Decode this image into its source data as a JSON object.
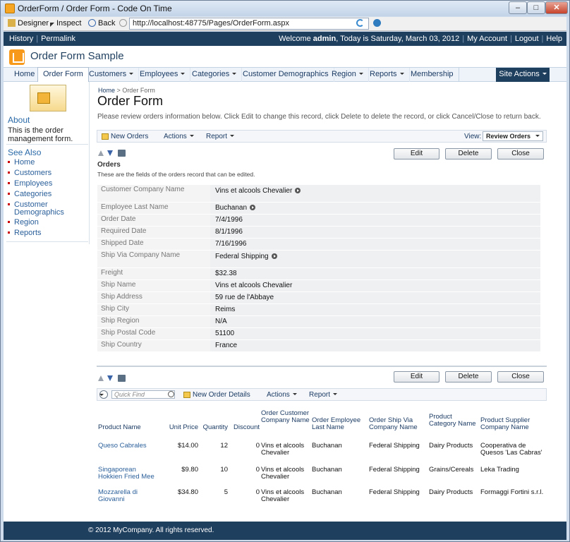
{
  "window": {
    "title": "OrderForm / Order Form - Code On Time"
  },
  "browser": {
    "designer": "Designer",
    "inspect": "Inspect",
    "back": "Back",
    "url": "http://localhost:48775/Pages/OrderForm.aspx"
  },
  "topbar": {
    "history": "History",
    "permalink": "Permalink",
    "welcome_prefix": "Welcome ",
    "user": "admin",
    "welcome_suffix": ", Today is Saturday, March 03, 2012",
    "my_account": "My Account",
    "logout": "Logout",
    "help": "Help"
  },
  "app": {
    "title": "Order Form Sample"
  },
  "menu": {
    "items": [
      "Home",
      "Order Form",
      "Customers",
      "Employees",
      "Categories",
      "Customer Demographics",
      "Region",
      "Reports",
      "Membership"
    ],
    "site_actions": "Site Actions"
  },
  "sidebar": {
    "about_h": "About",
    "about_text": "This is the order management form.",
    "seealso_h": "See Also",
    "links": [
      "Home",
      "Customers",
      "Employees",
      "Categories",
      "Customer Demographics",
      "Region",
      "Reports"
    ]
  },
  "page": {
    "crumb_home": "Home",
    "crumb_sep": ">",
    "crumb_current": "Order Form",
    "title": "Order Form",
    "description": "Please review orders information below. Click Edit to change this record, click Delete to delete the record, or click Cancel/Close to return back."
  },
  "actionbar": {
    "new_orders": "New Orders",
    "actions": "Actions",
    "report": "Report",
    "view_label": "View:",
    "view_value": "Review Orders"
  },
  "buttons": {
    "edit": "Edit",
    "delete": "Delete",
    "close": "Close"
  },
  "orders": {
    "title": "Orders",
    "desc": "These are the fields of the orders record that can be edited.",
    "fields": [
      {
        "label": "Customer Company Name",
        "value": "Vins et alcools Chevalier"
      },
      {
        "label": "Employee Last Name",
        "value": "Buchanan"
      },
      {
        "label": "Order Date",
        "value": "7/4/1996"
      },
      {
        "label": "Required Date",
        "value": "8/1/1996"
      },
      {
        "label": "Shipped Date",
        "value": "7/16/1996"
      },
      {
        "label": "Ship Via Company Name",
        "value": "Federal Shipping"
      },
      {
        "label": "Freight",
        "value": "$32.38"
      },
      {
        "label": "Ship Name",
        "value": "Vins et alcools Chevalier"
      },
      {
        "label": "Ship Address",
        "value": "59 rue de l'Abbaye"
      },
      {
        "label": "Ship City",
        "value": "Reims"
      },
      {
        "label": "Ship Region",
        "value": "N/A"
      },
      {
        "label": "Ship Postal Code",
        "value": "51100"
      },
      {
        "label": "Ship Country",
        "value": "France"
      }
    ]
  },
  "details": {
    "quick_find": "Quick Find",
    "new_order_details": "New Order Details",
    "actions": "Actions",
    "report": "Report",
    "headers": [
      "Product Name",
      "Unit Price",
      "Quantity",
      "Discount",
      "Order Customer Company Name",
      "Order Employee Last Name",
      "Order Ship Via Company Name",
      "Product Category Name",
      "Product Supplier Company Name"
    ],
    "rows": [
      {
        "product": "Queso Cabrales",
        "price": "$14.00",
        "qty": "12",
        "discount": "0",
        "customer": "Vins et alcools Chevalier",
        "employee": "Buchanan",
        "shipvia": "Federal Shipping",
        "category": "Dairy Products",
        "supplier": "Cooperativa de Quesos 'Las Cabras'"
      },
      {
        "product": "Singaporean Hokkien Fried Mee",
        "price": "$9.80",
        "qty": "10",
        "discount": "0",
        "customer": "Vins et alcools Chevalier",
        "employee": "Buchanan",
        "shipvia": "Federal Shipping",
        "category": "Grains/Cereals",
        "supplier": "Leka Trading"
      },
      {
        "product": "Mozzarella di Giovanni",
        "price": "$34.80",
        "qty": "5",
        "discount": "0",
        "customer": "Vins et alcools Chevalier",
        "employee": "Buchanan",
        "shipvia": "Federal Shipping",
        "category": "Dairy Products",
        "supplier": "Formaggi Fortini s.r.l."
      }
    ]
  },
  "footer": {
    "text": "© 2012 MyCompany. All rights reserved."
  }
}
